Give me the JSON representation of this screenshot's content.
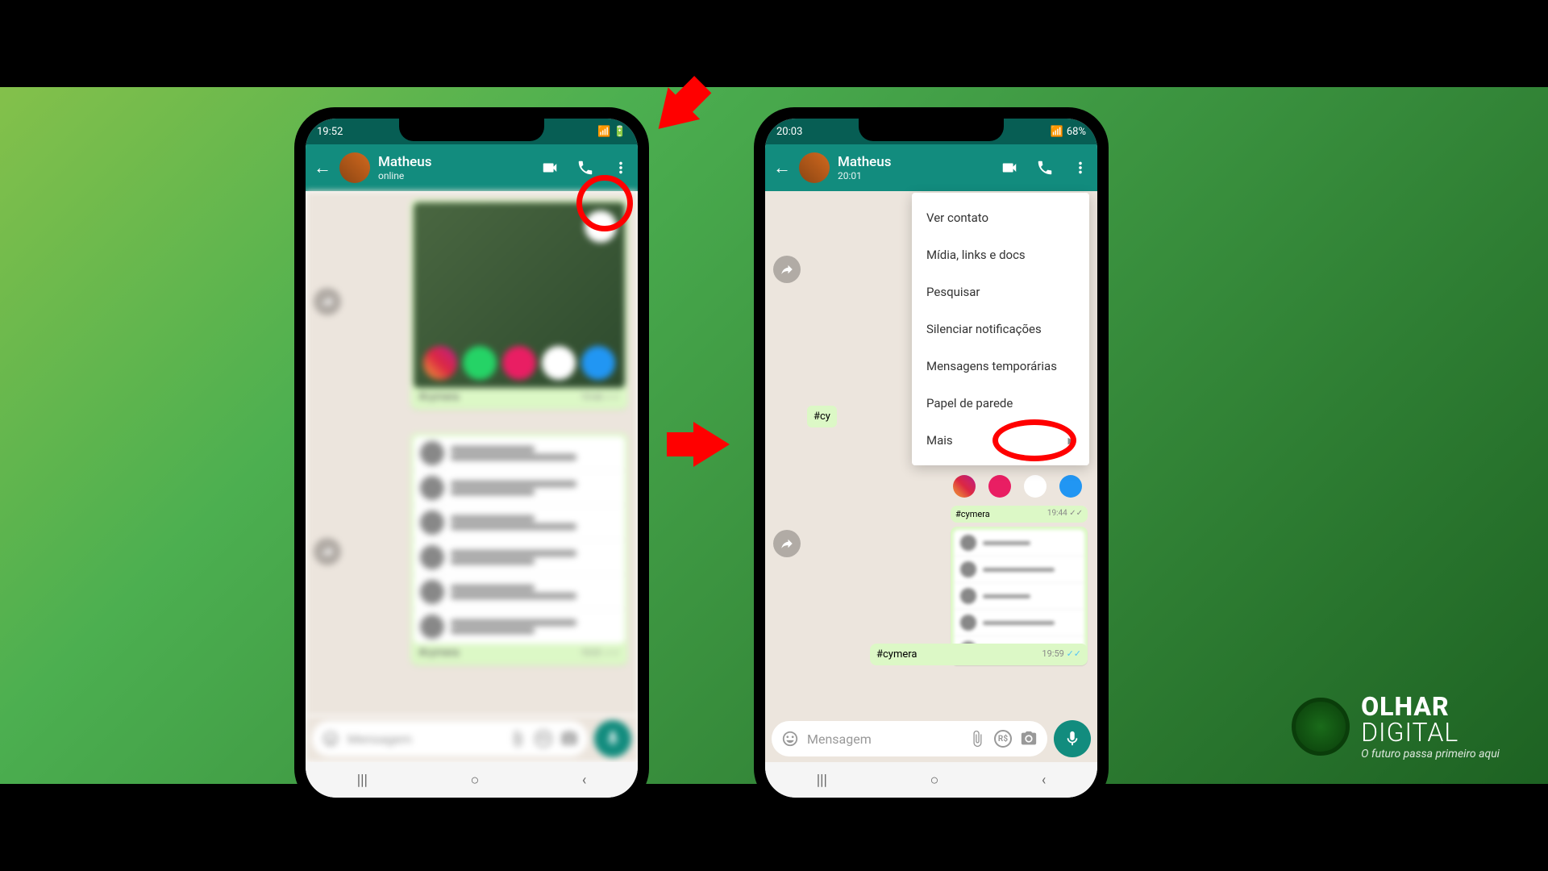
{
  "phone1": {
    "statusTime": "19:52",
    "contactName": "Matheus",
    "contactStatus": "online",
    "caption1": "#cymera",
    "time1": "19:44",
    "caption2": "#cymera",
    "time2": "19:51",
    "inputPlaceholder": "Mensagem"
  },
  "phone2": {
    "statusTime": "20:03",
    "battery": "68%",
    "contactName": "Matheus",
    "contactStatus": "20:01",
    "cyPartial": "#cy",
    "smallCaption": "#cymera",
    "smallTime": "19:44",
    "caption2": "#cymera",
    "time2": "19:59",
    "inputPlaceholder": "Mensagem"
  },
  "menu": {
    "items": [
      "Ver contato",
      "Mídia, links e docs",
      "Pesquisar",
      "Silenciar notificações",
      "Mensagens temporárias",
      "Papel de parede"
    ],
    "more": "Mais"
  },
  "brand": {
    "line1": "OLHAR",
    "line2": "DIGITAL",
    "tagline": "O futuro passa primeiro aqui"
  },
  "rs": "R$"
}
